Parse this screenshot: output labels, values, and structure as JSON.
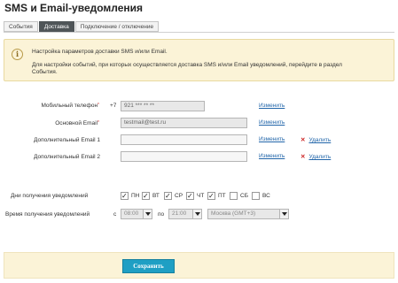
{
  "page": {
    "title": "SMS и Email-уведомления"
  },
  "tabs": [
    {
      "label": "События",
      "active": false
    },
    {
      "label": "Доставка",
      "active": true
    },
    {
      "label": "Подключение / отключение",
      "active": false
    }
  ],
  "notice": {
    "icon": "info-icon",
    "line1": "Настройка параметров доставки SMS и/или Email.",
    "line2": "Для настройки событий, при которых осуществляется доставка SMS и/или Email уведомлений, перейдите в раздел",
    "line3": "События."
  },
  "form": {
    "phone": {
      "label": "Мобильный телефон",
      "required_mark": "*",
      "prefix": "+7",
      "value": "921 *** ** **",
      "action": "Изменить"
    },
    "email_main": {
      "label": "Основной Email",
      "required_mark": "*",
      "value": "testmail@test.ru",
      "action": "Изменить"
    },
    "email_extra1": {
      "label": "Дополнительный Email 1",
      "value": "",
      "action": "Изменить",
      "delete": "Удалить"
    },
    "email_extra2": {
      "label": "Дополнительный Email 2",
      "value": "",
      "action": "Изменить",
      "delete": "Удалить"
    },
    "days": {
      "label": "Дни получения уведомлений",
      "items": [
        {
          "label": "ПН",
          "checked": true
        },
        {
          "label": "ВТ",
          "checked": true
        },
        {
          "label": "СР",
          "checked": true
        },
        {
          "label": "ЧТ",
          "checked": true
        },
        {
          "label": "ПТ",
          "checked": true
        },
        {
          "label": "СБ",
          "checked": false
        },
        {
          "label": "ВС",
          "checked": false
        }
      ]
    },
    "time": {
      "label": "Время получения уведомлений",
      "from_label": "с",
      "from_value": "08:00",
      "to_label": "по",
      "to_value": "21:00",
      "timezone": "Москва (GMT+3)"
    }
  },
  "footer": {
    "save_label": "Сохранить"
  },
  "colors": {
    "accent": "#1f9fc4",
    "notice_bg": "#fbf3d7",
    "link": "#2266aa",
    "delete": "#cc2222",
    "tab_active": "#4f5558"
  }
}
